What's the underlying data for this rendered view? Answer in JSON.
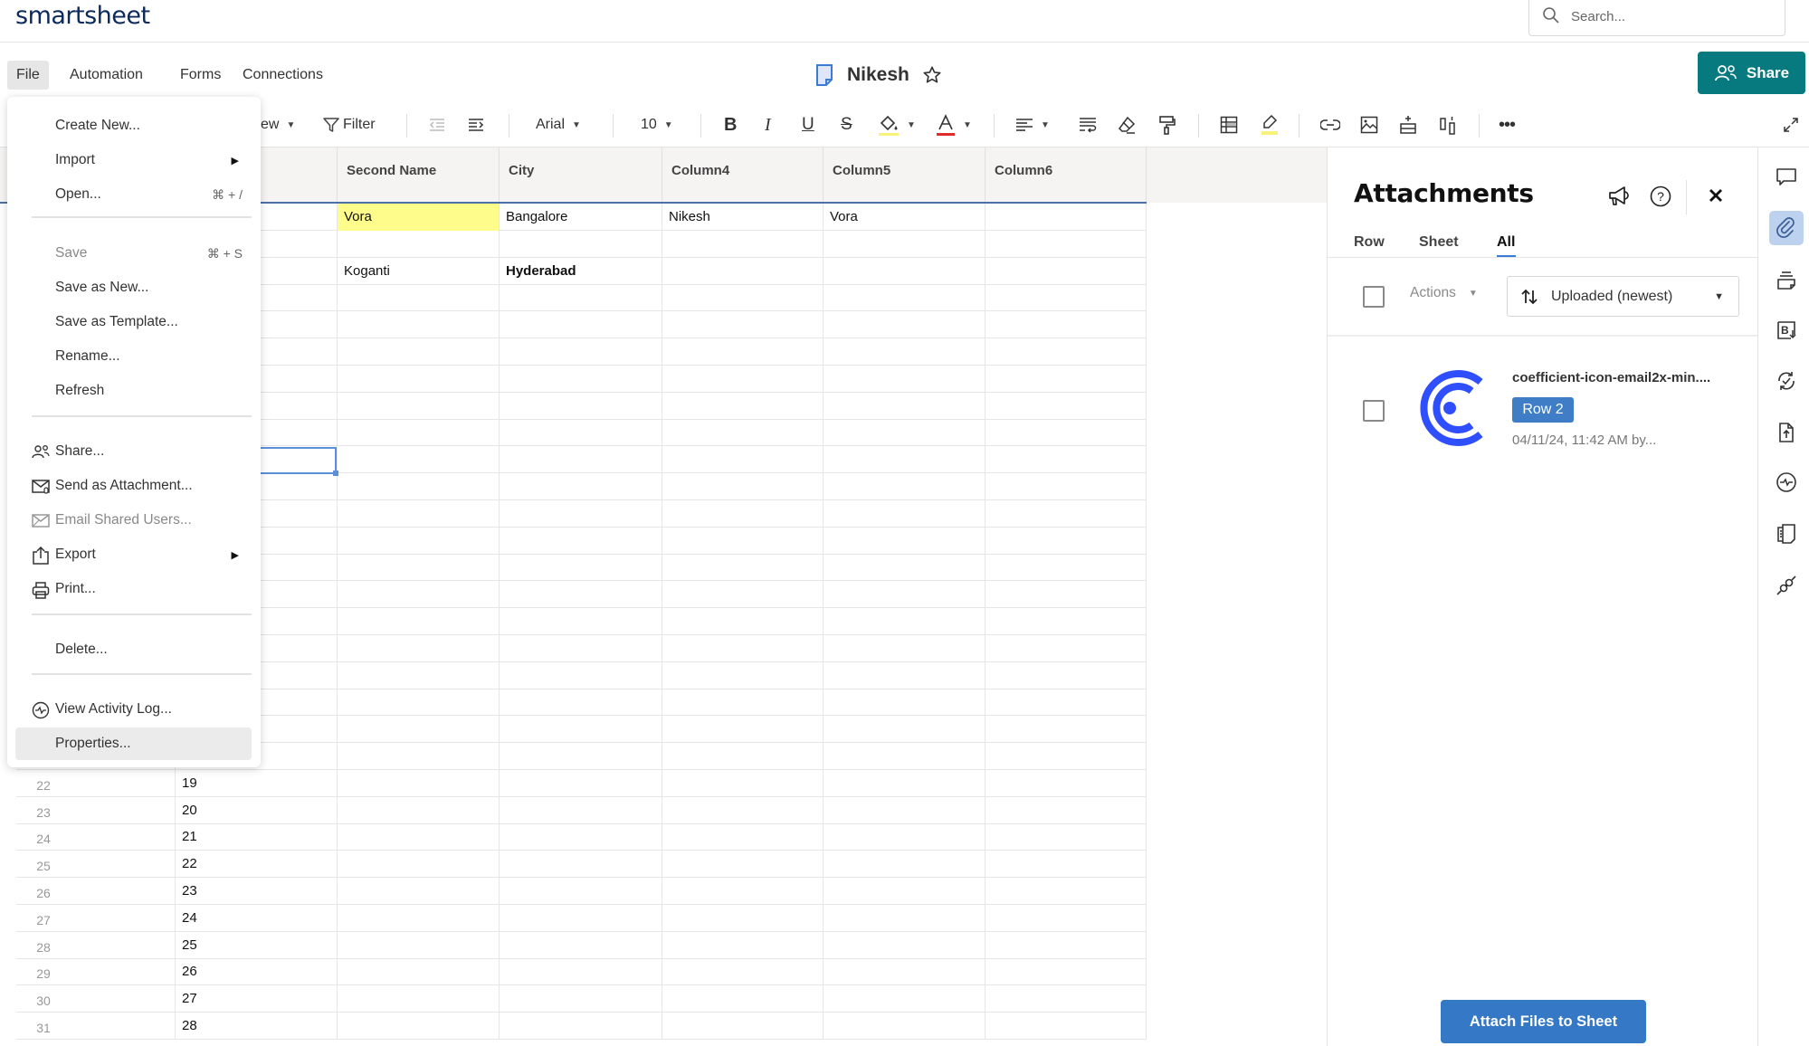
{
  "app": {
    "logo_text": "smartsheet",
    "search_placeholder": "Search..."
  },
  "menubar": {
    "items": [
      "File",
      "Automation",
      "Forms",
      "Connections"
    ],
    "active": "File"
  },
  "sheet": {
    "title": "Nikesh"
  },
  "share_button": {
    "label": "Share"
  },
  "toolbar": {
    "view_label_fragment": "ew",
    "filter_label": "Filter",
    "font_family": "Arial",
    "font_size": "10",
    "icons": [
      "outdent-icon",
      "indent-icon",
      "bold-icon",
      "italic-icon",
      "underline-icon",
      "strikethrough-icon",
      "fill-color-icon",
      "text-color-icon",
      "align-left-icon",
      "wrap-text-icon",
      "clear-format-icon",
      "format-painter-icon",
      "grid-icon",
      "highlight-icon",
      "link-icon",
      "image-icon",
      "insert-row-icon",
      "insert-column-icon",
      "more-icon",
      "expand-icon"
    ],
    "colors": {
      "fill_swatch": "#f8f27a",
      "text_swatch": "#e02b2b"
    }
  },
  "grid": {
    "columns": [
      "",
      "Second Name",
      "City",
      "Column4",
      "Column5",
      "Column6"
    ],
    "top_rows": [
      {
        "cells": [
          "",
          "Vora",
          "Bangalore",
          "Nikesh",
          "Vora",
          ""
        ],
        "highlight_col": 1
      },
      {
        "cells": [
          "",
          "",
          "",
          "",
          "",
          ""
        ]
      },
      {
        "cells": [
          "",
          "Koganti",
          "Hyderabad",
          "",
          "",
          ""
        ],
        "bold_col": 2
      }
    ],
    "bottom_rows": [
      {
        "num": "22",
        "primary": "19"
      },
      {
        "num": "23",
        "primary": "20"
      },
      {
        "num": "24",
        "primary": "21"
      },
      {
        "num": "25",
        "primary": "22"
      },
      {
        "num": "26",
        "primary": "23"
      },
      {
        "num": "27",
        "primary": "24"
      },
      {
        "num": "28",
        "primary": "25"
      },
      {
        "num": "29",
        "primary": "26"
      },
      {
        "num": "30",
        "primary": "27"
      },
      {
        "num": "31",
        "primary": "28"
      }
    ]
  },
  "file_menu": {
    "items": [
      {
        "label": "Create New..."
      },
      {
        "label": "Import",
        "submenu": true
      },
      {
        "label": "Open...",
        "shortcut": "⌘ + /"
      },
      {
        "label": "Save",
        "shortcut": "⌘ + S",
        "disabled": true
      },
      {
        "label": "Save as New..."
      },
      {
        "label": "Save as Template..."
      },
      {
        "label": "Rename..."
      },
      {
        "label": "Refresh"
      },
      {
        "label": "Share...",
        "icon": "share-users-icon"
      },
      {
        "label": "Send as Attachment...",
        "icon": "mail-attachment-icon"
      },
      {
        "label": "Email Shared Users...",
        "icon": "mail-icon",
        "disabled": true
      },
      {
        "label": "Export",
        "icon": "export-icon",
        "submenu": true
      },
      {
        "label": "Print...",
        "icon": "print-icon"
      },
      {
        "label": "Delete..."
      },
      {
        "label": "View Activity Log...",
        "icon": "activity-icon"
      },
      {
        "label": "Properties...",
        "hovered": true
      }
    ]
  },
  "attachments_panel": {
    "title": "Attachments",
    "tabs": [
      "Row",
      "Sheet",
      "All"
    ],
    "active_tab": "All",
    "actions_label": "Actions",
    "sort_label": "Uploaded (newest)",
    "items": [
      {
        "name": "coefficient-icon-email2x-min....",
        "badge": "Row 2",
        "meta": "04/11/24, 11:42 AM by..."
      }
    ],
    "attach_button": "Attach Files to Sheet"
  },
  "right_rail": {
    "items": [
      "conversations-icon",
      "attachments-icon",
      "proofs-icon",
      "summary-icon",
      "update-requests-icon",
      "publish-icon",
      "activity-log-icon",
      "forms-icon",
      "connections-icon"
    ],
    "active": "attachments-icon"
  },
  "colors": {
    "brand_teal": "#077a80",
    "primary_blue": "#3478c6",
    "cell_highlight": "#fefd8b",
    "coefficient_logo": "#2f4fff"
  }
}
